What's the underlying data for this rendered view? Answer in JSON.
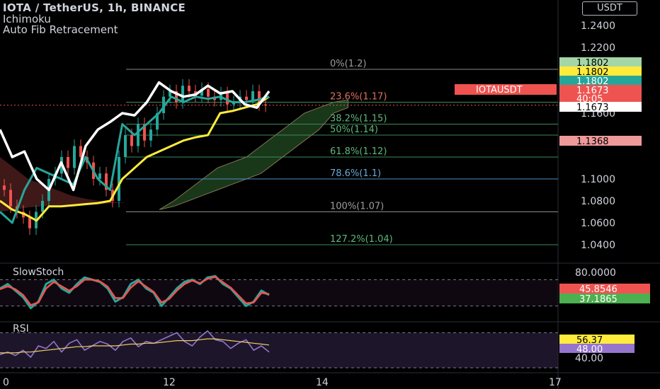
{
  "header": {
    "title": "IOTA / TetherUS, 1h, BINANCE",
    "indicator_1": "Ichimoku",
    "indicator_2": "Auto Fib Retracement",
    "currency_button": "USDT"
  },
  "colors": {
    "background": "#000000",
    "price_line_white": "#ffffff",
    "kijun_yellow": "#ffeb3b",
    "tenkan_teal": "#26a69a",
    "candle_up": "#26a69a",
    "candle_down": "#ef5350",
    "cloud_bull": "#1b3a1b",
    "cloud_bear": "#4a1c1c",
    "stoch_k": "#26a69a",
    "stoch_d": "#ef5350",
    "rsi": "#9575cd",
    "rsi_ma": "#f0d060"
  },
  "chart_data": [
    {
      "type": "line",
      "panel": "price",
      "y_axis_ticks": [
        "1.2400",
        "1.2200",
        "1.1600",
        "1.1000",
        "1.0800",
        "1.0600",
        "1.0400"
      ],
      "ylim": [
        1.03,
        1.255
      ],
      "x_tick_labels": [
        "0",
        "12",
        "14",
        "17"
      ],
      "fib_levels": [
        {
          "label": "0%(1.2)",
          "value": 1.2
        },
        {
          "label": "23.6%(1.17)",
          "value": 1.17
        },
        {
          "label": "38.2%(1.15)",
          "value": 1.15
        },
        {
          "label": "50%(1.14)",
          "value": 1.14
        },
        {
          "label": "61.8%(1.12)",
          "value": 1.12
        },
        {
          "label": "78.6%(1.1)",
          "value": 1.1
        },
        {
          "label": "100%(1.07)",
          "value": 1.07
        },
        {
          "label": "127.2%(1.04)",
          "value": 1.04
        }
      ],
      "price_labels": [
        {
          "text": "1.1802",
          "value": 1.1802,
          "bg": "#a5d6a7",
          "fg": "#000000"
        },
        {
          "text": "1.1802",
          "value": 1.1802,
          "bg": "#ffeb3b",
          "fg": "#000000"
        },
        {
          "text": "1.1802",
          "value": 1.1802,
          "bg": "#26a69a",
          "fg": "#ffffff"
        },
        {
          "text": "1.1673",
          "value": 1.1673,
          "bg": "#ef5350",
          "fg": "#ffffff"
        },
        {
          "text": "40:05",
          "value": 1.1673,
          "bg": "#ef5350",
          "fg": "#ffffff"
        },
        {
          "text": "1.1673",
          "value": 1.1673,
          "bg": "#ffffff",
          "fg": "#000000"
        },
        {
          "text": "1.1368",
          "value": 1.1368,
          "bg": "#ef9a9a",
          "fg": "#000000"
        }
      ],
      "symbol_label": "IOTAUSDT",
      "series": [
        {
          "name": "white-line",
          "values": [
            1.145,
            1.12,
            1.125,
            1.1,
            1.09,
            1.115,
            1.09,
            1.13,
            1.145,
            1.152,
            1.16,
            1.158,
            1.17,
            1.188,
            1.18,
            1.175,
            1.177,
            1.185,
            1.178,
            1.18,
            1.168,
            1.165,
            1.18
          ]
        },
        {
          "name": "kijun",
          "values": [
            1.08,
            1.072,
            1.068,
            1.062,
            1.075,
            1.075,
            1.076,
            1.077,
            1.078,
            1.08,
            1.1,
            1.11,
            1.12,
            1.125,
            1.13,
            1.135,
            1.138,
            1.14,
            1.16,
            1.162,
            1.165,
            1.168,
            1.175
          ]
        },
        {
          "name": "tenkan",
          "values": [
            1.07,
            1.06,
            1.09,
            1.11,
            1.105,
            1.1,
            1.095,
            1.12,
            1.1,
            1.09,
            1.15,
            1.14,
            1.15,
            1.16,
            1.175,
            1.17,
            1.175,
            1.173,
            1.175,
            1.17,
            1.17,
            1.172,
            1.175
          ]
        }
      ],
      "candles_close": [
        1.09,
        1.075,
        1.07,
        1.065,
        1.055,
        1.07,
        1.08,
        1.1,
        1.105,
        1.12,
        1.11,
        1.13,
        1.12,
        1.115,
        1.1,
        1.105,
        1.09,
        1.08,
        1.12,
        1.14,
        1.13,
        1.15,
        1.135,
        1.145,
        1.16,
        1.175,
        1.18,
        1.17,
        1.185,
        1.18,
        1.176,
        1.182,
        1.175,
        1.172,
        1.178,
        1.168,
        1.17,
        1.175,
        1.172,
        1.18,
        1.168,
        1.167
      ]
    },
    {
      "type": "line",
      "panel": "slow-stoch",
      "title": "SlowStoch",
      "y_axis_ticks": [
        "80.0000"
      ],
      "value_labels": [
        {
          "text": "45.8546",
          "bg": "#ef5350"
        },
        {
          "text": "37.1865",
          "bg": "#4caf50"
        }
      ],
      "series": [
        {
          "name": "%K",
          "values": [
            60,
            70,
            55,
            40,
            15,
            30,
            70,
            80,
            60,
            50,
            70,
            85,
            80,
            75,
            60,
            30,
            40,
            70,
            80,
            60,
            50,
            20,
            40,
            60,
            75,
            80,
            70,
            85,
            88,
            70,
            60,
            40,
            20,
            30,
            55,
            45
          ]
        },
        {
          "name": "%D",
          "values": [
            58,
            65,
            58,
            45,
            22,
            28,
            60,
            75,
            65,
            55,
            65,
            80,
            80,
            76,
            64,
            38,
            38,
            62,
            76,
            64,
            52,
            28,
            36,
            55,
            70,
            78,
            72,
            82,
            86,
            74,
            62,
            44,
            26,
            28,
            50,
            47
          ]
        }
      ]
    },
    {
      "type": "line",
      "panel": "rsi",
      "title": "RSI",
      "y_axis_ticks": [
        "40.00"
      ],
      "value_labels": [
        {
          "text": "56.37",
          "bg": "#ffeb3b"
        },
        {
          "text": "48.00",
          "bg": "#9575cd"
        }
      ],
      "series": [
        {
          "name": "RSI",
          "values": [
            45,
            48,
            44,
            50,
            42,
            55,
            52,
            60,
            48,
            58,
            62,
            50,
            55,
            60,
            57,
            50,
            60,
            64,
            54,
            60,
            58,
            62,
            66,
            70,
            60,
            55,
            65,
            72,
            62,
            60,
            52,
            58,
            62,
            50,
            55,
            48
          ]
        },
        {
          "name": "RSI-MA",
          "values": [
            47,
            47,
            47,
            48,
            48,
            49,
            50,
            51,
            52,
            53,
            54,
            54,
            55,
            55,
            55,
            55,
            56,
            57,
            57,
            58,
            58,
            59,
            60,
            61,
            61,
            61,
            62,
            63,
            63,
            62,
            61,
            60,
            59,
            58,
            57,
            56
          ]
        }
      ]
    }
  ]
}
